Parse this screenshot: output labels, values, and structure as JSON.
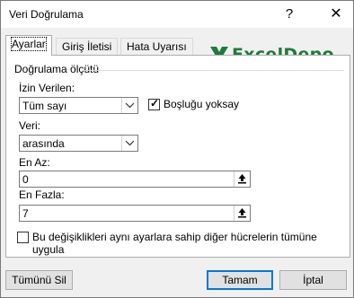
{
  "window": {
    "title": "Veri Doğrulama",
    "help_label": "?",
    "close_label": "✕"
  },
  "tabs": [
    {
      "label": "Ayarlar",
      "active": true
    },
    {
      "label": "Giriş İletisi",
      "active": false
    },
    {
      "label": "Hata Uyarısı",
      "active": false
    }
  ],
  "logo": {
    "text": "ExcelDepo",
    "color": "#1e7b3c",
    "icon": "x-mark-icon"
  },
  "criteria": {
    "section_label": "Doğrulama ölçütü",
    "allow_label": "İzin Verilen:",
    "allow_value": "Tüm sayı",
    "ignore_blank_label": "Boşluğu yoksay",
    "ignore_blank_checked": true,
    "data_label": "Veri:",
    "data_value": "arasında",
    "min_label": "En Az:",
    "min_value": "0",
    "max_label": "En Fazla:",
    "max_value": "7",
    "apply_all_label": "Bu değişiklikleri aynı ayarlara sahip diğer hücrelerin tümüne uygula",
    "apply_all_checked": false
  },
  "buttons": {
    "clear_all": "Tümünü Sil",
    "ok": "Tamam",
    "cancel": "İptal"
  }
}
